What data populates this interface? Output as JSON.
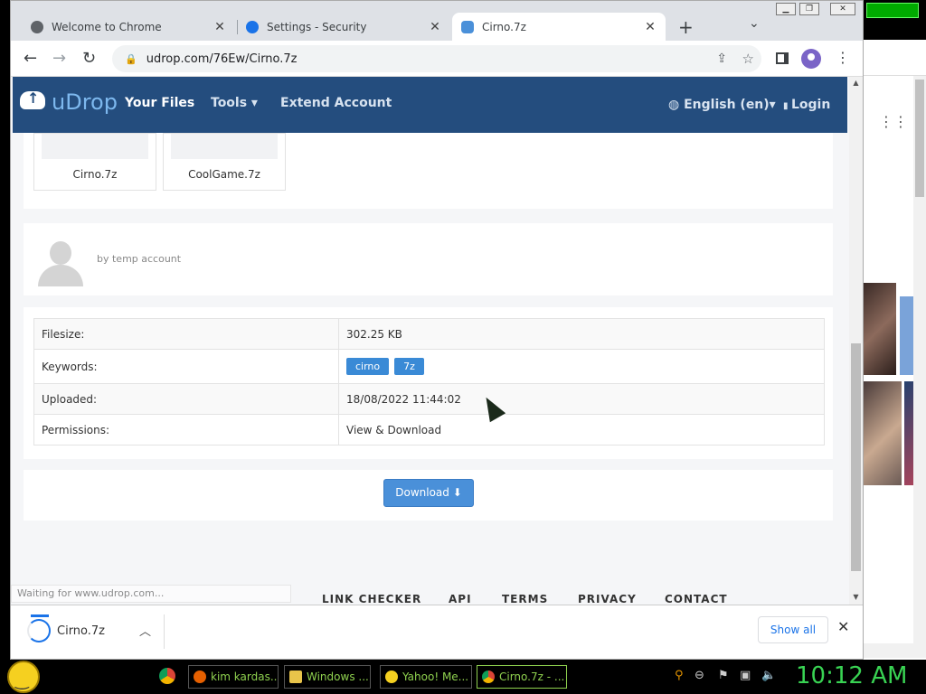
{
  "browser": {
    "tabs": [
      {
        "label": "Welcome to Chrome",
        "icon": "globe-icon"
      },
      {
        "label": "Settings - Security",
        "icon": "gear-icon"
      },
      {
        "label": "Cirno.7z",
        "icon": "udrop-cloud-icon",
        "active": true
      }
    ],
    "url": "udrop.com/76Ew/Cirno.7z"
  },
  "site": {
    "brand": "uDrop",
    "nav": {
      "your_files": "Your Files",
      "tools": "Tools ▾",
      "extend": "Extend Account"
    },
    "language": "English (en)▾",
    "login": "Login",
    "accent": "#244d7e"
  },
  "files": [
    {
      "name": "Cirno.7z"
    },
    {
      "name": "CoolGame.7z"
    }
  ],
  "uploader": "by temp account",
  "details": {
    "filesize_label": "Filesize:",
    "filesize_value": "302.25 KB",
    "keywords_label": "Keywords:",
    "keywords": [
      "cirno",
      "7z"
    ],
    "uploaded_label": "Uploaded:",
    "uploaded_value": "18/08/2022 11:44:02",
    "permissions_label": "Permissions:",
    "permissions_value": "View & Download"
  },
  "download_label": "Download ⬇",
  "footer": [
    "LINK CHECKER",
    "API",
    "TERMS",
    "PRIVACY",
    "CONTACT"
  ],
  "status_text": "Waiting for www.udrop.com...",
  "downloads_bar": {
    "file": "Cirno.7z",
    "show_all": "Show all"
  },
  "taskbar": {
    "items": [
      {
        "label": "kim kardas...",
        "icon": "firefox-icon"
      },
      {
        "label": "Windows ...",
        "icon": "folder-icon"
      },
      {
        "label": "Yahoo! Me...",
        "icon": "yahoo-messenger-icon"
      },
      {
        "label": "Cirno.7z - ...",
        "icon": "chrome-icon"
      }
    ],
    "clock": "10:12 AM"
  }
}
